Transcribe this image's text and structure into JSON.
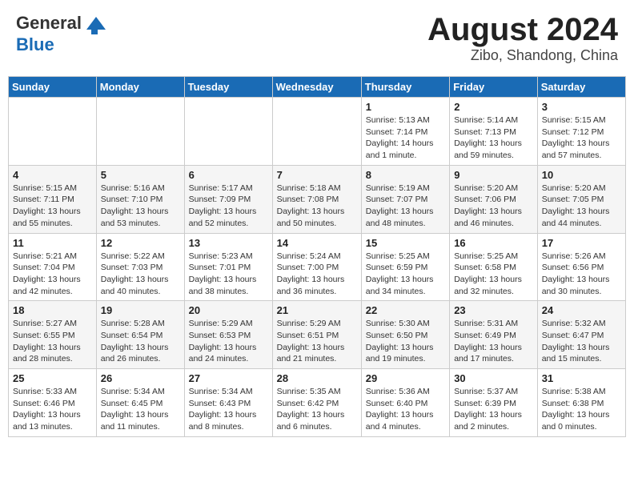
{
  "header": {
    "logo_general": "General",
    "logo_blue": "Blue",
    "month_title": "August 2024",
    "location": "Zibo, Shandong, China"
  },
  "weekdays": [
    "Sunday",
    "Monday",
    "Tuesday",
    "Wednesday",
    "Thursday",
    "Friday",
    "Saturday"
  ],
  "weeks": [
    [
      {
        "day": "",
        "info": ""
      },
      {
        "day": "",
        "info": ""
      },
      {
        "day": "",
        "info": ""
      },
      {
        "day": "",
        "info": ""
      },
      {
        "day": "1",
        "info": "Sunrise: 5:13 AM\nSunset: 7:14 PM\nDaylight: 14 hours\nand 1 minute."
      },
      {
        "day": "2",
        "info": "Sunrise: 5:14 AM\nSunset: 7:13 PM\nDaylight: 13 hours\nand 59 minutes."
      },
      {
        "day": "3",
        "info": "Sunrise: 5:15 AM\nSunset: 7:12 PM\nDaylight: 13 hours\nand 57 minutes."
      }
    ],
    [
      {
        "day": "4",
        "info": "Sunrise: 5:15 AM\nSunset: 7:11 PM\nDaylight: 13 hours\nand 55 minutes."
      },
      {
        "day": "5",
        "info": "Sunrise: 5:16 AM\nSunset: 7:10 PM\nDaylight: 13 hours\nand 53 minutes."
      },
      {
        "day": "6",
        "info": "Sunrise: 5:17 AM\nSunset: 7:09 PM\nDaylight: 13 hours\nand 52 minutes."
      },
      {
        "day": "7",
        "info": "Sunrise: 5:18 AM\nSunset: 7:08 PM\nDaylight: 13 hours\nand 50 minutes."
      },
      {
        "day": "8",
        "info": "Sunrise: 5:19 AM\nSunset: 7:07 PM\nDaylight: 13 hours\nand 48 minutes."
      },
      {
        "day": "9",
        "info": "Sunrise: 5:20 AM\nSunset: 7:06 PM\nDaylight: 13 hours\nand 46 minutes."
      },
      {
        "day": "10",
        "info": "Sunrise: 5:20 AM\nSunset: 7:05 PM\nDaylight: 13 hours\nand 44 minutes."
      }
    ],
    [
      {
        "day": "11",
        "info": "Sunrise: 5:21 AM\nSunset: 7:04 PM\nDaylight: 13 hours\nand 42 minutes."
      },
      {
        "day": "12",
        "info": "Sunrise: 5:22 AM\nSunset: 7:03 PM\nDaylight: 13 hours\nand 40 minutes."
      },
      {
        "day": "13",
        "info": "Sunrise: 5:23 AM\nSunset: 7:01 PM\nDaylight: 13 hours\nand 38 minutes."
      },
      {
        "day": "14",
        "info": "Sunrise: 5:24 AM\nSunset: 7:00 PM\nDaylight: 13 hours\nand 36 minutes."
      },
      {
        "day": "15",
        "info": "Sunrise: 5:25 AM\nSunset: 6:59 PM\nDaylight: 13 hours\nand 34 minutes."
      },
      {
        "day": "16",
        "info": "Sunrise: 5:25 AM\nSunset: 6:58 PM\nDaylight: 13 hours\nand 32 minutes."
      },
      {
        "day": "17",
        "info": "Sunrise: 5:26 AM\nSunset: 6:56 PM\nDaylight: 13 hours\nand 30 minutes."
      }
    ],
    [
      {
        "day": "18",
        "info": "Sunrise: 5:27 AM\nSunset: 6:55 PM\nDaylight: 13 hours\nand 28 minutes."
      },
      {
        "day": "19",
        "info": "Sunrise: 5:28 AM\nSunset: 6:54 PM\nDaylight: 13 hours\nand 26 minutes."
      },
      {
        "day": "20",
        "info": "Sunrise: 5:29 AM\nSunset: 6:53 PM\nDaylight: 13 hours\nand 24 minutes."
      },
      {
        "day": "21",
        "info": "Sunrise: 5:29 AM\nSunset: 6:51 PM\nDaylight: 13 hours\nand 21 minutes."
      },
      {
        "day": "22",
        "info": "Sunrise: 5:30 AM\nSunset: 6:50 PM\nDaylight: 13 hours\nand 19 minutes."
      },
      {
        "day": "23",
        "info": "Sunrise: 5:31 AM\nSunset: 6:49 PM\nDaylight: 13 hours\nand 17 minutes."
      },
      {
        "day": "24",
        "info": "Sunrise: 5:32 AM\nSunset: 6:47 PM\nDaylight: 13 hours\nand 15 minutes."
      }
    ],
    [
      {
        "day": "25",
        "info": "Sunrise: 5:33 AM\nSunset: 6:46 PM\nDaylight: 13 hours\nand 13 minutes."
      },
      {
        "day": "26",
        "info": "Sunrise: 5:34 AM\nSunset: 6:45 PM\nDaylight: 13 hours\nand 11 minutes."
      },
      {
        "day": "27",
        "info": "Sunrise: 5:34 AM\nSunset: 6:43 PM\nDaylight: 13 hours\nand 8 minutes."
      },
      {
        "day": "28",
        "info": "Sunrise: 5:35 AM\nSunset: 6:42 PM\nDaylight: 13 hours\nand 6 minutes."
      },
      {
        "day": "29",
        "info": "Sunrise: 5:36 AM\nSunset: 6:40 PM\nDaylight: 13 hours\nand 4 minutes."
      },
      {
        "day": "30",
        "info": "Sunrise: 5:37 AM\nSunset: 6:39 PM\nDaylight: 13 hours\nand 2 minutes."
      },
      {
        "day": "31",
        "info": "Sunrise: 5:38 AM\nSunset: 6:38 PM\nDaylight: 13 hours\nand 0 minutes."
      }
    ]
  ]
}
